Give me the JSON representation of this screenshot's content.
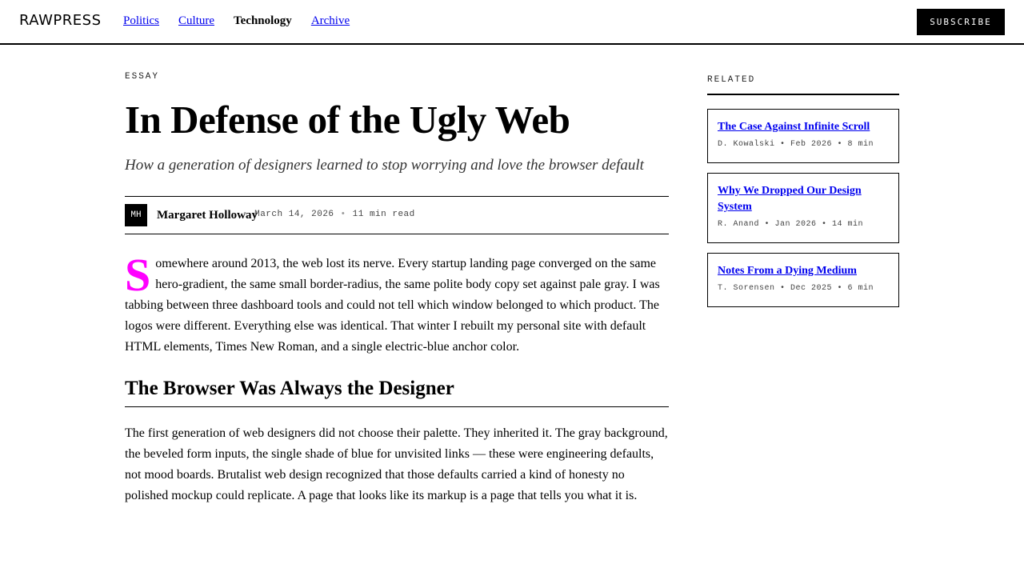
{
  "header": {
    "logo": "RAWPRESS",
    "nav": [
      {
        "label": "Politics"
      },
      {
        "label": "Culture"
      },
      {
        "label": "Technology"
      },
      {
        "label": "Archive"
      }
    ],
    "active_nav": "Technology",
    "subscribe_label": "SUBSCRIBE"
  },
  "article": {
    "kicker": "ESSAY",
    "title": "In Defense of the Ugly Web",
    "dek": "How a generation of designers learned to stop worrying and love the browser default",
    "byline": {
      "initials": "MH",
      "author": "Margaret Holloway",
      "date": "March 14, 2026",
      "read_time": "11 min read",
      "separator": "•"
    },
    "paragraph1_dropcap": "S",
    "paragraph1_rest": "omewhere around 2013, the web lost its nerve. Every startup landing page converged on the same hero-gradient, the same small border-radius, the same polite body copy set against pale gray. I was tabbing between three dashboard tools and could not tell which window belonged to which product. The logos were different. Everything else was identical. That winter I rebuilt my personal site with default HTML elements, Times New Roman, and a single electric-blue anchor color.",
    "heading2": "The Browser Was Always the Designer",
    "paragraph2": "The first generation of web designers did not choose their palette. They inherited it. The gray background, the beveled form inputs, the single shade of blue for unvisited links — these were engineering defaults, not mood boards. Brutalist web design recognized that those defaults carried a kind of honesty no polished mockup could replicate. A page that looks like its markup is a page that tells you what it is."
  },
  "sidebar": {
    "label": "RELATED",
    "items": [
      {
        "title": "The Case Against Infinite Scroll",
        "meta": "D. Kowalski • Feb 2026 • 8 min"
      },
      {
        "title": "Why We Dropped Our Design System",
        "meta": "R. Anand • Jan 2026 • 14 min"
      },
      {
        "title": "Notes From a Dying Medium",
        "meta": "T. Sorensen • Dec 2025 • 6 min"
      }
    ]
  },
  "colors": {
    "link": "#0000ee",
    "dropcap": "#ff00ff",
    "ink": "#000000"
  }
}
